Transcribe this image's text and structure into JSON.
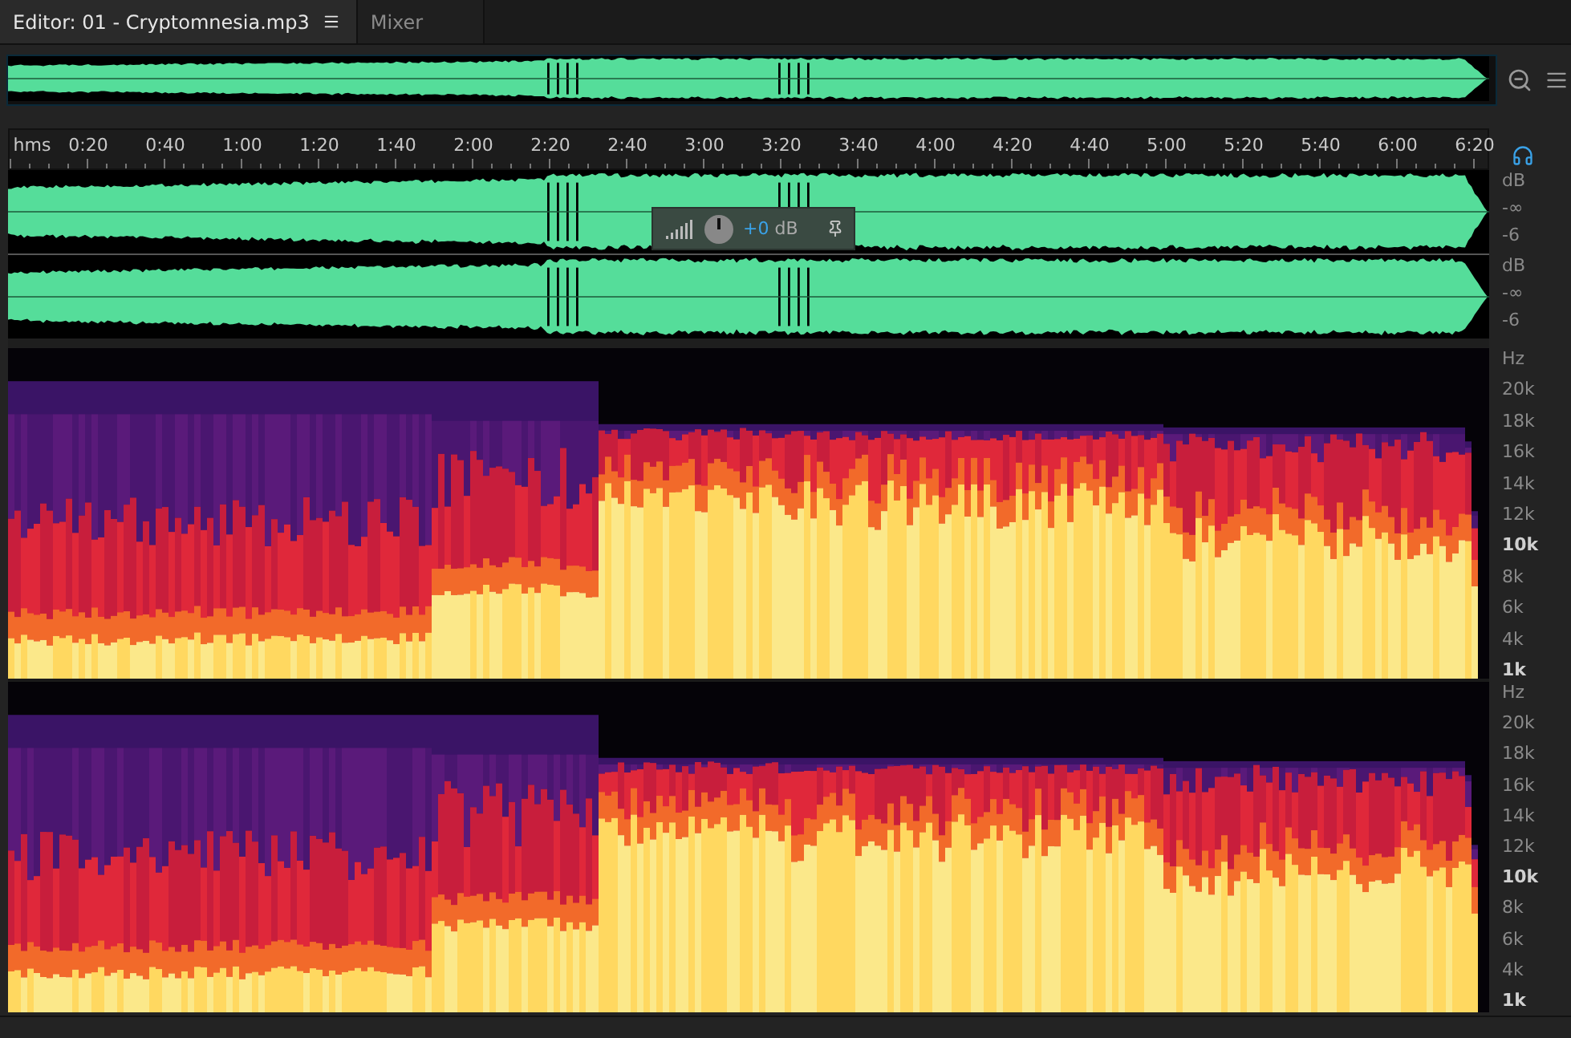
{
  "tabs": [
    {
      "label": "Editor: 01 - Cryptomnesia.mp3",
      "selected": true
    },
    {
      "label": "Mixer",
      "selected": false
    }
  ],
  "ruler": {
    "unit": "hms",
    "labels": [
      "0:20",
      "0:40",
      "1:00",
      "1:20",
      "1:40",
      "2:00",
      "2:20",
      "2:40",
      "3:00",
      "3:20",
      "3:40",
      "4:00",
      "4:20",
      "4:40",
      "5:00",
      "5:20",
      "5:40",
      "6:00",
      "6:20"
    ]
  },
  "hud": {
    "value": "+0",
    "unit": "dB"
  },
  "waveform_channels": [
    {
      "scale": [
        "dB",
        "-∞",
        "-6"
      ]
    },
    {
      "scale": [
        "dB",
        "-∞",
        "-6"
      ]
    }
  ],
  "spectral_channels": [
    {
      "unit": "Hz",
      "ticks": [
        {
          "label": "20k",
          "bold": false
        },
        {
          "label": "18k",
          "bold": false
        },
        {
          "label": "16k",
          "bold": false
        },
        {
          "label": "14k",
          "bold": false
        },
        {
          "label": "12k",
          "bold": false
        },
        {
          "label": "10k",
          "bold": true
        },
        {
          "label": "8k",
          "bold": false
        },
        {
          "label": "6k",
          "bold": false
        },
        {
          "label": "4k",
          "bold": false
        },
        {
          "label": "1k",
          "bold": true
        }
      ]
    },
    {
      "unit": "Hz",
      "ticks": [
        {
          "label": "20k",
          "bold": false
        },
        {
          "label": "18k",
          "bold": false
        },
        {
          "label": "16k",
          "bold": false
        },
        {
          "label": "14k",
          "bold": false
        },
        {
          "label": "12k",
          "bold": false
        },
        {
          "label": "10k",
          "bold": true
        },
        {
          "label": "8k",
          "bold": false
        },
        {
          "label": "6k",
          "bold": false
        },
        {
          "label": "4k",
          "bold": false
        },
        {
          "label": "1k",
          "bold": true
        }
      ]
    }
  ]
}
